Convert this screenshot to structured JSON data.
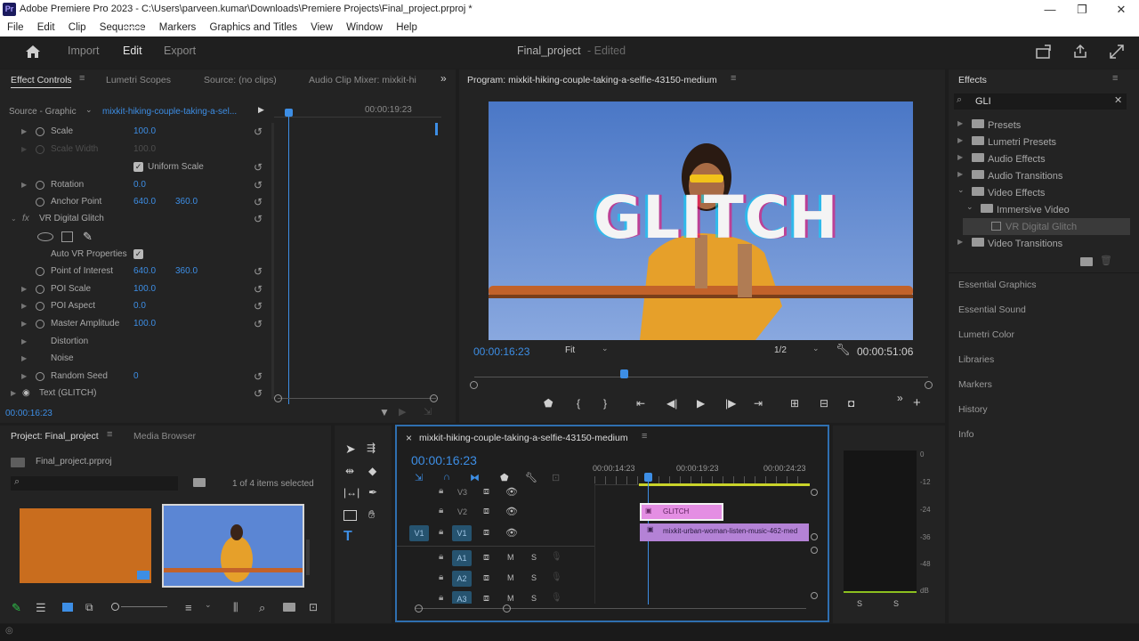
{
  "window": {
    "title": "Adobe Premiere Pro 2023 - C:\\Users\\parveen.kumar\\Downloads\\Premiere Projects\\Final_project.prproj *"
  },
  "menu": [
    "File",
    "Edit",
    "Clip",
    "Sequence",
    "Markers",
    "Graphics and Titles",
    "View",
    "Window",
    "Help"
  ],
  "header": {
    "import": "Import",
    "edit": "Edit",
    "export": "Export",
    "project_name": "Final_project",
    "status": "- Edited"
  },
  "effect_controls": {
    "tabs": [
      "Effect Controls",
      "Lumetri Scopes",
      "Source: (no clips)",
      "Audio Clip Mixer: mixkit-hi"
    ],
    "source_label": "Source - Graphic",
    "clip_name": "mixkit-hiking-couple-taking-a-sel...",
    "ruler_time": "00:00:19:23",
    "current_time": "00:00:16:23",
    "props": {
      "scale": {
        "label": "Scale",
        "value": "100.0"
      },
      "scale_width": {
        "label": "Scale Width",
        "value": "100.0"
      },
      "uniform_scale": "Uniform Scale",
      "rotation": {
        "label": "Rotation",
        "value": "0.0"
      },
      "anchor": {
        "label": "Anchor Point",
        "x": "640.0",
        "y": "360.0"
      },
      "effect_name": "VR Digital Glitch",
      "auto_vr": "Auto VR Properties",
      "poi": {
        "label": "Point of Interest",
        "x": "640.0",
        "y": "360.0"
      },
      "poi_scale": {
        "label": "POI Scale",
        "value": "100.0"
      },
      "poi_aspect": {
        "label": "POI Aspect",
        "value": "0.0"
      },
      "master_amp": {
        "label": "Master Amplitude",
        "value": "100.0"
      },
      "distortion": "Distortion",
      "noise": "Noise",
      "random_seed": {
        "label": "Random Seed",
        "value": "0"
      },
      "text_layer": "Text (GLITCH)"
    }
  },
  "program": {
    "title": "Program: mixkit-hiking-couple-taking-a-selfie-43150-medium",
    "overlay_text": "GLITCH",
    "timecode": "00:00:16:23",
    "fit": "Fit",
    "resolution": "1/2",
    "duration": "00:00:51:06",
    "playhead_fraction": 0.33
  },
  "effects": {
    "title": "Effects",
    "search": "GLI",
    "tree": [
      "Presets",
      "Lumetri Presets",
      "Audio Effects",
      "Audio Transitions",
      "Video Effects",
      "Immersive Video",
      "VR Digital Glitch",
      "Video Transitions"
    ],
    "panels": [
      "Essential Graphics",
      "Essential Sound",
      "Lumetri Color",
      "Libraries",
      "Markers",
      "History",
      "Info"
    ]
  },
  "project": {
    "tabs": [
      "Project: Final_project",
      "Media Browser"
    ],
    "file": "Final_project.prproj",
    "selection": "1 of 4 items selected"
  },
  "timeline": {
    "title": "mixkit-hiking-couple-taking-a-selfie-43150-medium",
    "timecode": "00:00:16:23",
    "ruler": [
      "00:00:14:23",
      "00:00:19:23",
      "00:00:24:23"
    ],
    "video_tracks": [
      "V3",
      "V2",
      "V1"
    ],
    "audio_tracks": [
      "A1",
      "A2",
      "A3"
    ],
    "source_patch_v": "V1",
    "clip_glitch": "GLITCH",
    "clip_audio": "mixkit-urban-woman-listen-music-462-med"
  },
  "meter": {
    "scale": [
      "0",
      "-12",
      "-24",
      "-36",
      "-48",
      "dB"
    ],
    "solo": [
      "S",
      "S"
    ]
  },
  "colors": {
    "accent": "#3d8ee5",
    "panel": "#232323",
    "clip_pink": "#e48ee3",
    "clip_purple": "#b482d6",
    "orange": "#c96d1e"
  }
}
